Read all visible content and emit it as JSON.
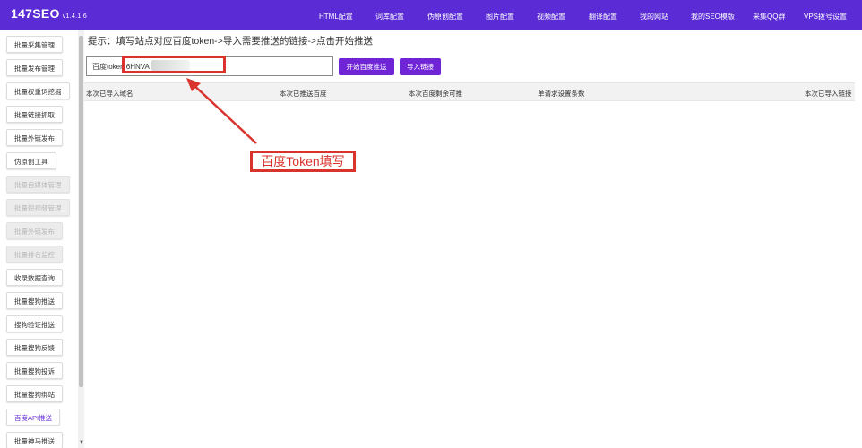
{
  "header": {
    "brand": "147SEO",
    "version": "v1.4.1.6",
    "nav": [
      "HTML配置",
      "词库配置",
      "伪原创配置",
      "图片配置",
      "视频配置",
      "翻译配置",
      "我的网站",
      "我的SEO模版",
      "采集QQ群",
      "VPS拨号设置"
    ]
  },
  "sidebar": {
    "items": [
      {
        "label": "批量采集管理",
        "state": "normal"
      },
      {
        "label": "批量发布管理",
        "state": "normal"
      },
      {
        "label": "批量权重词挖掘",
        "state": "normal"
      },
      {
        "label": "批量链接抓取",
        "state": "normal"
      },
      {
        "label": "批量外链发布",
        "state": "normal"
      },
      {
        "label": "伪原创工具",
        "state": "normal"
      },
      {
        "label": "批量自媒体管理",
        "state": "disabled"
      },
      {
        "label": "批量短视频管理",
        "state": "disabled"
      },
      {
        "label": "批量外链发布",
        "state": "disabled"
      },
      {
        "label": "批量排名监控",
        "state": "disabled"
      },
      {
        "label": "收录数据查询",
        "state": "normal"
      },
      {
        "label": "批量搜狗推送",
        "state": "normal"
      },
      {
        "label": "搜狗验证推送",
        "state": "normal"
      },
      {
        "label": "批量搜狗反馈",
        "state": "normal"
      },
      {
        "label": "批量搜狗投诉",
        "state": "normal"
      },
      {
        "label": "批量搜狗绑站",
        "state": "normal"
      },
      {
        "label": "百度API推送",
        "state": "active"
      },
      {
        "label": "批量神马推送",
        "state": "normal"
      }
    ]
  },
  "main": {
    "hint": "提示：填写站点对应百度token->导入需要推送的链接->点击开始推送",
    "token_value": "百度token 6HNVA",
    "start_button": "开始百度推送",
    "import_button": "导入链接",
    "table_headers": [
      "本次已导入域名",
      "本次已推送百度",
      "本次百度剩余可推",
      "单请求设置条数",
      "本次已导入链接"
    ]
  },
  "annotation": {
    "label": "百度Token填写",
    "color": "#d9332e"
  },
  "colors": {
    "topbar": "#5b2bd6",
    "button": "#6f24d6",
    "active_text": "#6a30d8"
  }
}
